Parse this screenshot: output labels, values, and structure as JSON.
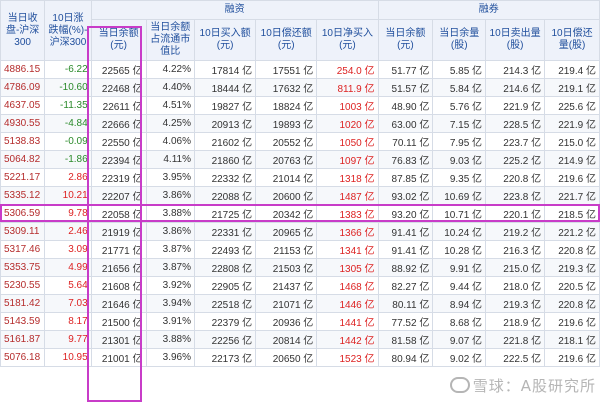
{
  "header": {
    "group_margin": "融资",
    "group_short": "融券",
    "col_close": "当日收盘-沪深300",
    "col_chg": "10日涨跌幅(%)-沪深300",
    "col_balance": "当日余额(元)",
    "col_ratio": "当日余额占流通市值比",
    "col_buy": "10日买入额(元)",
    "col_repay": "10日偿还额(元)",
    "col_net": "10日净买入(元)",
    "col_s_balance": "当日余额(元)",
    "col_s_qty": "当日余量(股)",
    "col_s_sell": "10日卖出量(股)",
    "col_s_repay": "10日偿还量(股)"
  },
  "rows": [
    {
      "close": "4886.15",
      "chg": "-6.22",
      "balance": "22565 亿",
      "ratio": "4.22%",
      "buy": "17814 亿",
      "repay": "17551 亿",
      "net": "254.0 亿",
      "s_balance": "51.77 亿",
      "s_qty": "5.85 亿",
      "s_sell": "214.3 亿",
      "s_repay": "219.4 亿"
    },
    {
      "close": "4786.09",
      "chg": "-10.60",
      "balance": "22468 亿",
      "ratio": "4.40%",
      "buy": "18444 亿",
      "repay": "17632 亿",
      "net": "811.9 亿",
      "s_balance": "51.57 亿",
      "s_qty": "5.84 亿",
      "s_sell": "214.6 亿",
      "s_repay": "219.1 亿"
    },
    {
      "close": "4637.05",
      "chg": "-11.35",
      "balance": "22611 亿",
      "ratio": "4.51%",
      "buy": "19827 亿",
      "repay": "18824 亿",
      "net": "1003 亿",
      "s_balance": "48.90 亿",
      "s_qty": "5.76 亿",
      "s_sell": "221.9 亿",
      "s_repay": "225.6 亿"
    },
    {
      "close": "4930.55",
      "chg": "-4.84",
      "balance": "22666 亿",
      "ratio": "4.25%",
      "buy": "20913 亿",
      "repay": "19893 亿",
      "net": "1020 亿",
      "s_balance": "63.00 亿",
      "s_qty": "7.15 亿",
      "s_sell": "228.5 亿",
      "s_repay": "221.9 亿"
    },
    {
      "close": "5138.83",
      "chg": "-0.09",
      "balance": "22550 亿",
      "ratio": "4.06%",
      "buy": "21602 亿",
      "repay": "20552 亿",
      "net": "1050 亿",
      "s_balance": "70.11 亿",
      "s_qty": "7.95 亿",
      "s_sell": "223.7 亿",
      "s_repay": "215.0 亿"
    },
    {
      "close": "5064.82",
      "chg": "-1.86",
      "balance": "22394 亿",
      "ratio": "4.11%",
      "buy": "21860 亿",
      "repay": "20763 亿",
      "net": "1097 亿",
      "s_balance": "76.83 亿",
      "s_qty": "9.03 亿",
      "s_sell": "225.2 亿",
      "s_repay": "214.9 亿"
    },
    {
      "close": "5221.17",
      "chg": "2.86",
      "balance": "22319 亿",
      "ratio": "3.95%",
      "buy": "22332 亿",
      "repay": "21014 亿",
      "net": "1318 亿",
      "s_balance": "87.85 亿",
      "s_qty": "9.35 亿",
      "s_sell": "220.8 亿",
      "s_repay": "219.6 亿"
    },
    {
      "close": "5335.12",
      "chg": "10.21",
      "balance": "22207 亿",
      "ratio": "3.86%",
      "buy": "22088 亿",
      "repay": "20600 亿",
      "net": "1487 亿",
      "s_balance": "93.02 亿",
      "s_qty": "10.69 亿",
      "s_sell": "223.8 亿",
      "s_repay": "221.7 亿"
    },
    {
      "close": "5306.59",
      "chg": "9.78",
      "balance": "22058 亿",
      "ratio": "3.88%",
      "buy": "21725 亿",
      "repay": "20342 亿",
      "net": "1383 亿",
      "s_balance": "93.20 亿",
      "s_qty": "10.71 亿",
      "s_sell": "220.1 亿",
      "s_repay": "218.5 亿"
    },
    {
      "close": "5309.11",
      "chg": "2.46",
      "balance": "21919 亿",
      "ratio": "3.86%",
      "buy": "22331 亿",
      "repay": "20965 亿",
      "net": "1366 亿",
      "s_balance": "91.41 亿",
      "s_qty": "10.24 亿",
      "s_sell": "219.2 亿",
      "s_repay": "221.2 亿"
    },
    {
      "close": "5317.46",
      "chg": "3.09",
      "balance": "21771 亿",
      "ratio": "3.87%",
      "buy": "22493 亿",
      "repay": "21153 亿",
      "net": "1341 亿",
      "s_balance": "91.41 亿",
      "s_qty": "10.28 亿",
      "s_sell": "216.3 亿",
      "s_repay": "220.8 亿"
    },
    {
      "close": "5353.75",
      "chg": "4.99",
      "balance": "21656 亿",
      "ratio": "3.87%",
      "buy": "22808 亿",
      "repay": "21503 亿",
      "net": "1305 亿",
      "s_balance": "88.92 亿",
      "s_qty": "9.91 亿",
      "s_sell": "215.0 亿",
      "s_repay": "219.3 亿"
    },
    {
      "close": "5230.55",
      "chg": "5.64",
      "balance": "21608 亿",
      "ratio": "3.92%",
      "buy": "22905 亿",
      "repay": "21437 亿",
      "net": "1468 亿",
      "s_balance": "82.27 亿",
      "s_qty": "9.44 亿",
      "s_sell": "218.0 亿",
      "s_repay": "220.5 亿"
    },
    {
      "close": "5181.42",
      "chg": "7.03",
      "balance": "21646 亿",
      "ratio": "3.94%",
      "buy": "22518 亿",
      "repay": "21071 亿",
      "net": "1446 亿",
      "s_balance": "80.11 亿",
      "s_qty": "8.94 亿",
      "s_sell": "219.3 亿",
      "s_repay": "220.8 亿"
    },
    {
      "close": "5143.59",
      "chg": "8.17",
      "balance": "21500 亿",
      "ratio": "3.91%",
      "buy": "22379 亿",
      "repay": "20936 亿",
      "net": "1441 亿",
      "s_balance": "77.52 亿",
      "s_qty": "8.68 亿",
      "s_sell": "218.9 亿",
      "s_repay": "219.6 亿"
    },
    {
      "close": "5161.87",
      "chg": "9.77",
      "balance": "21301 亿",
      "ratio": "3.88%",
      "buy": "22256 亿",
      "repay": "20814 亿",
      "net": "1442 亿",
      "s_balance": "81.58 亿",
      "s_qty": "9.07 亿",
      "s_sell": "221.8 亿",
      "s_repay": "218.1 亿"
    },
    {
      "close": "5076.18",
      "chg": "10.95",
      "balance": "21001 亿",
      "ratio": "3.96%",
      "buy": "22173 亿",
      "repay": "20650 亿",
      "net": "1523 亿",
      "s_balance": "80.94 亿",
      "s_qty": "9.02 亿",
      "s_sell": "222.5 亿",
      "s_repay": "219.6 亿"
    }
  ],
  "watermark": "雪球：A股研究所",
  "colors": {
    "highlight": "#c83cc8",
    "header_text": "#1f4e9c",
    "up": "#dd2222",
    "down": "#2a8a2a"
  }
}
